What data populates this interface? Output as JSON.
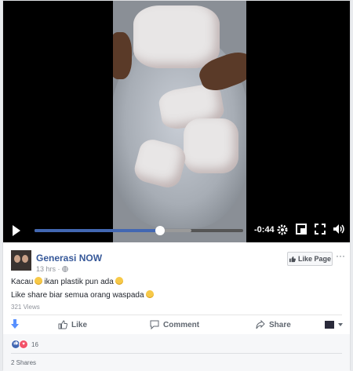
{
  "video": {
    "time_remaining": "-0:44",
    "progress": 0.6,
    "buffered": 0.75,
    "icons": [
      "play-icon",
      "settings-gear-icon",
      "picture-in-picture-icon",
      "fullscreen-icon",
      "volume-icon"
    ]
  },
  "post": {
    "page_name": "Generasi NOW",
    "meta": "13 hrs · ",
    "like_page_label": "Like Page",
    "more_label": "···",
    "line1_a": "Kacau",
    "line1_b": "ikan plastik pun ada",
    "line2": "Like share biar semua orang waspada",
    "views": "321 Views"
  },
  "actions": {
    "like_label": "Like",
    "comment_label": "Comment",
    "share_label": "Share"
  },
  "footer": {
    "reaction_count": "16",
    "shares": "2 Shares"
  },
  "colors": {
    "link_blue": "#365899",
    "progress_blue": "#4267b2",
    "like_reaction": "#4267b2",
    "love_reaction": "#f25268"
  }
}
